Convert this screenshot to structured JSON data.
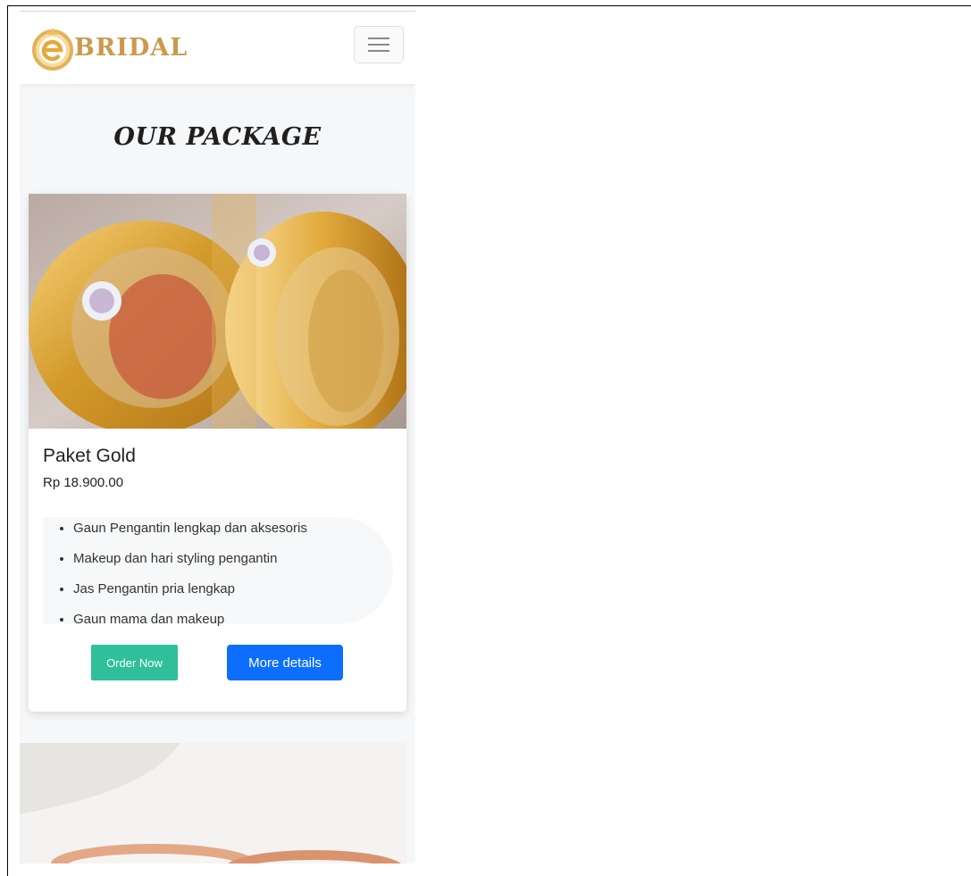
{
  "brand": {
    "name": "BRIDAL"
  },
  "section": {
    "title": "OUR PACKAGE"
  },
  "package": {
    "name": "Paket Gold",
    "price": "Rp 18.900.00",
    "features": [
      "Gaun Pengantin lengkap dan aksesoris",
      "Makeup dan hari styling pengantin",
      "Jas Pengantin pria lengkap",
      "Gaun mama dan makeup"
    ],
    "order_label": "Order Now",
    "details_label": "More details"
  },
  "colors": {
    "brand_gold": "#c99a4e",
    "order_button": "#2fbf9b",
    "details_button": "#0d6efd",
    "page_bg": "#f6f7f8"
  },
  "icons": {
    "logo": "e-ring-logo-icon",
    "menu": "hamburger-menu-icon"
  }
}
